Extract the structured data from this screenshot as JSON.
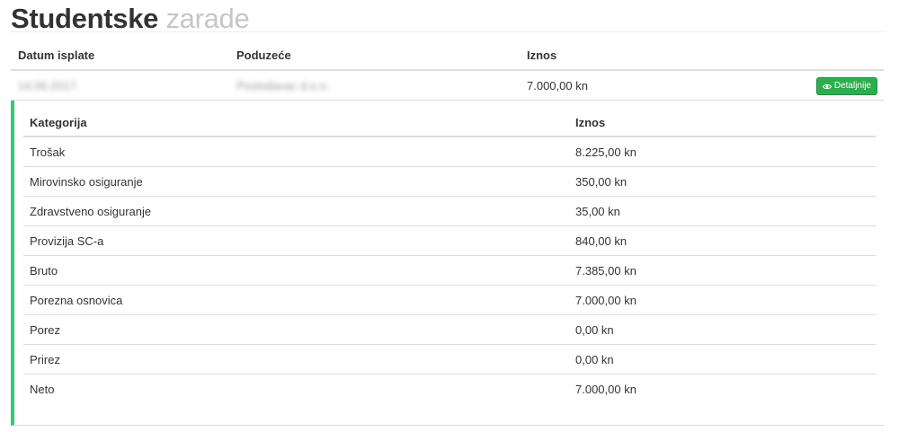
{
  "page": {
    "title_main": "Studentske",
    "title_muted": "zarade"
  },
  "payments_table": {
    "headers": {
      "date": "Datum isplate",
      "company": "Poduzeće",
      "amount": "Iznos"
    },
    "rows": [
      {
        "date": "14.06.2017.",
        "company": "Poslodavac d.o.o.",
        "amount": "7.000,00 kn",
        "details_label": "Detaljnije"
      }
    ]
  },
  "details_table": {
    "headers": {
      "category": "Kategorija",
      "amount": "Iznos"
    },
    "rows": [
      {
        "category": "Trošak",
        "amount": "8.225,00 kn"
      },
      {
        "category": "Mirovinsko osiguranje",
        "amount": "350,00 kn"
      },
      {
        "category": "Zdravstveno osiguranje",
        "amount": "35,00 kn"
      },
      {
        "category": "Provizija SC-a",
        "amount": "840,00 kn"
      },
      {
        "category": "Bruto",
        "amount": "7.385,00 kn"
      },
      {
        "category": "Porezna osnovica",
        "amount": "7.000,00 kn"
      },
      {
        "category": "Porez",
        "amount": "0,00 kn"
      },
      {
        "category": "Prirez",
        "amount": "0,00 kn"
      },
      {
        "category": "Neto",
        "amount": "7.000,00 kn"
      }
    ]
  },
  "icons": {
    "details_button_icon": "eye-icon"
  },
  "colors": {
    "accent_green": "#2ecc71",
    "button_green": "#2cae4c",
    "title_muted": "#c6c6c6"
  }
}
